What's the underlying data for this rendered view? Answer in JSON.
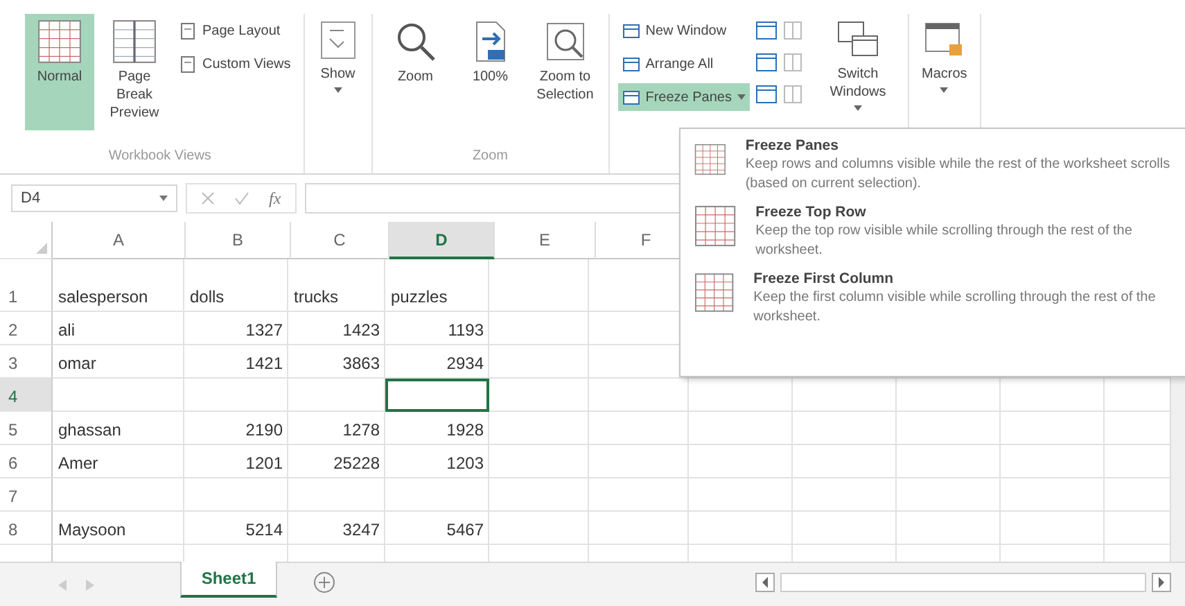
{
  "ribbon": {
    "workbook_views": {
      "label": "Workbook Views",
      "large": [
        {
          "label": "Normal",
          "selected": true
        },
        {
          "label": "Page Break Preview",
          "selected": false
        }
      ],
      "small": [
        "Page Layout",
        "Custom Views"
      ]
    },
    "show": {
      "label": "Show"
    },
    "zoom": {
      "label": "Zoom",
      "buttons": [
        "Zoom",
        "100%",
        "Zoom to Selection"
      ]
    },
    "window": {
      "small": [
        {
          "label": "New Window",
          "selected": false
        },
        {
          "label": "Arrange All",
          "selected": false
        },
        {
          "label": "Freeze Panes",
          "selected": true
        }
      ],
      "switch": "Switch Windows"
    },
    "macros": {
      "label": "Macros"
    }
  },
  "formula_bar": {
    "name_box": "D4",
    "fx": "fx"
  },
  "sheet": {
    "columns": [
      {
        "label": "A",
        "selected": false
      },
      {
        "label": "B",
        "selected": false
      },
      {
        "label": "C",
        "selected": false
      },
      {
        "label": "D",
        "selected": true
      },
      {
        "label": "E",
        "selected": false
      },
      {
        "label": "F",
        "selected": false
      }
    ],
    "rows": [
      {
        "number": "1",
        "selected": false,
        "kind": "header",
        "cells": [
          "salesperson",
          "dolls",
          "trucks",
          "puzzles"
        ]
      },
      {
        "number": "2",
        "selected": false,
        "kind": "data",
        "cells": [
          "ali",
          "1327",
          "1423",
          "1193"
        ]
      },
      {
        "number": "3",
        "selected": false,
        "kind": "data",
        "cells": [
          "omar",
          "1421",
          "3863",
          "2934"
        ]
      },
      {
        "number": "4",
        "selected": true
      },
      {
        "number": "5",
        "selected": false,
        "kind": "data",
        "cells": [
          "ghassan",
          "2190",
          "1278",
          "1928"
        ]
      },
      {
        "number": "6",
        "selected": false,
        "kind": "data",
        "cells": [
          "Amer",
          "1201",
          "25228",
          "1203"
        ]
      },
      {
        "number": "7",
        "selected": false
      },
      {
        "number": "8",
        "selected": false,
        "kind": "data",
        "cells": [
          "Maysoon",
          "5214",
          "3247",
          "5467"
        ]
      }
    ]
  },
  "freeze_menu": {
    "items": [
      {
        "title": "Freeze Panes",
        "description": "Keep rows and columns visible while the rest of the worksheet scrolls (based on current selection)."
      },
      {
        "title": "Freeze Top Row",
        "description": "Keep the top row visible while scrolling through the rest of the worksheet."
      },
      {
        "title": "Freeze First Column",
        "description": "Keep the first column visible while scrolling through the rest of the worksheet."
      }
    ]
  },
  "sheet_tabs": [
    {
      "label": "Sheet1",
      "selected": true
    }
  ]
}
